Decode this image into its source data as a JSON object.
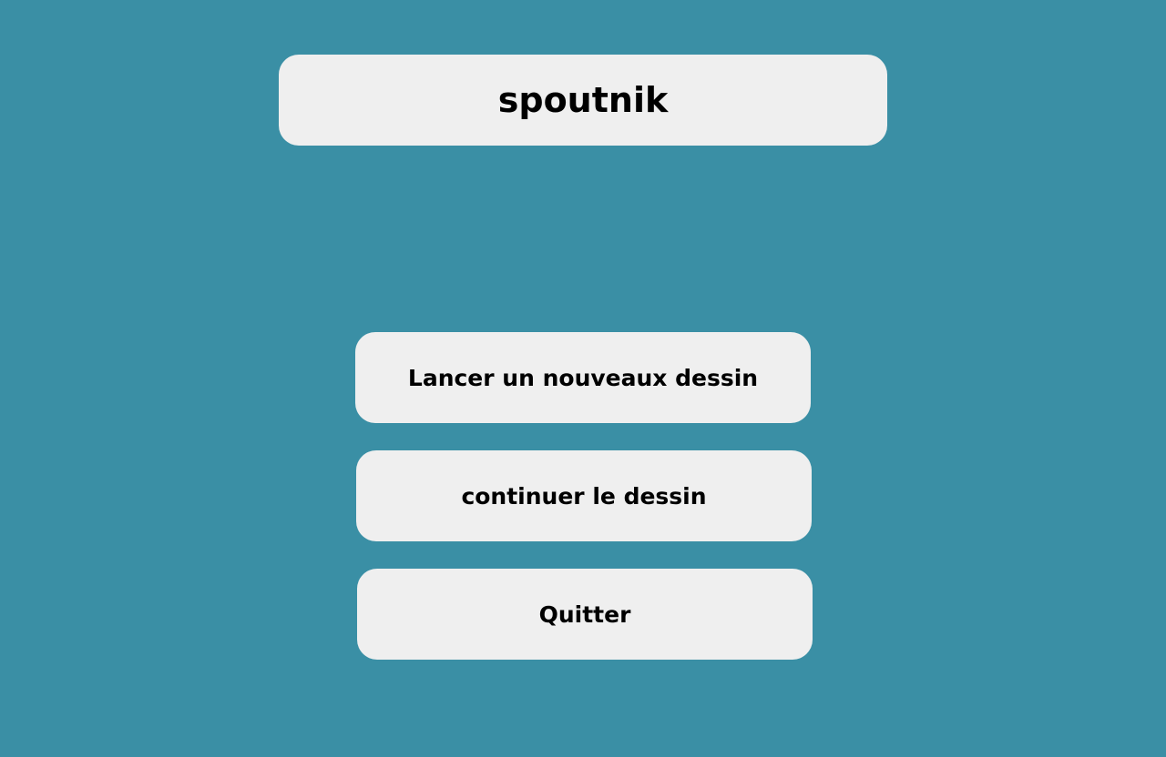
{
  "app": {
    "title": "spoutnik"
  },
  "menu": {
    "new_drawing_label": "Lancer un nouveaux dessin",
    "continue_drawing_label": "continuer le dessin",
    "quit_label": "Quitter"
  },
  "colors": {
    "background": "#3a8fa5",
    "panel": "#efefef",
    "text": "#000000"
  }
}
